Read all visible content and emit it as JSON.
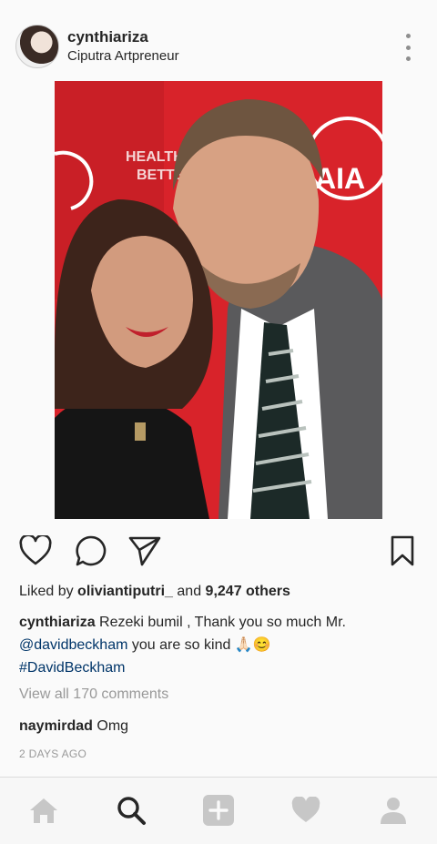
{
  "post": {
    "username": "cynthiariza",
    "location": "Ciputra Artpreneur",
    "likes": {
      "prefix": "Liked by ",
      "user": "oliviantiputri_",
      "and": " and ",
      "count": "9,247 others"
    },
    "caption": {
      "user": "cynthiariza",
      "text1": " Rezeki bumil , Thank you so much Mr. ",
      "mention": "@davidbeckham",
      "text2": " you are so kind 🙏🏻😊",
      "hashtag": "#DavidBeckham"
    },
    "view_all": "View all 170 comments",
    "comment": {
      "user": "naymirdad",
      "text": " Omg"
    },
    "time": "2 DAYS AGO",
    "photo_banner": {
      "text_line1": "HEALTHI",
      "text_line2": "BETTE",
      "logo_text": "AIA"
    }
  },
  "tabs": [
    "home-icon",
    "search-icon",
    "add-icon",
    "heart-icon",
    "profile-icon"
  ],
  "colors": {
    "accent_link": "#003569",
    "banner_red": "#d8232a",
    "muted": "#999999"
  }
}
